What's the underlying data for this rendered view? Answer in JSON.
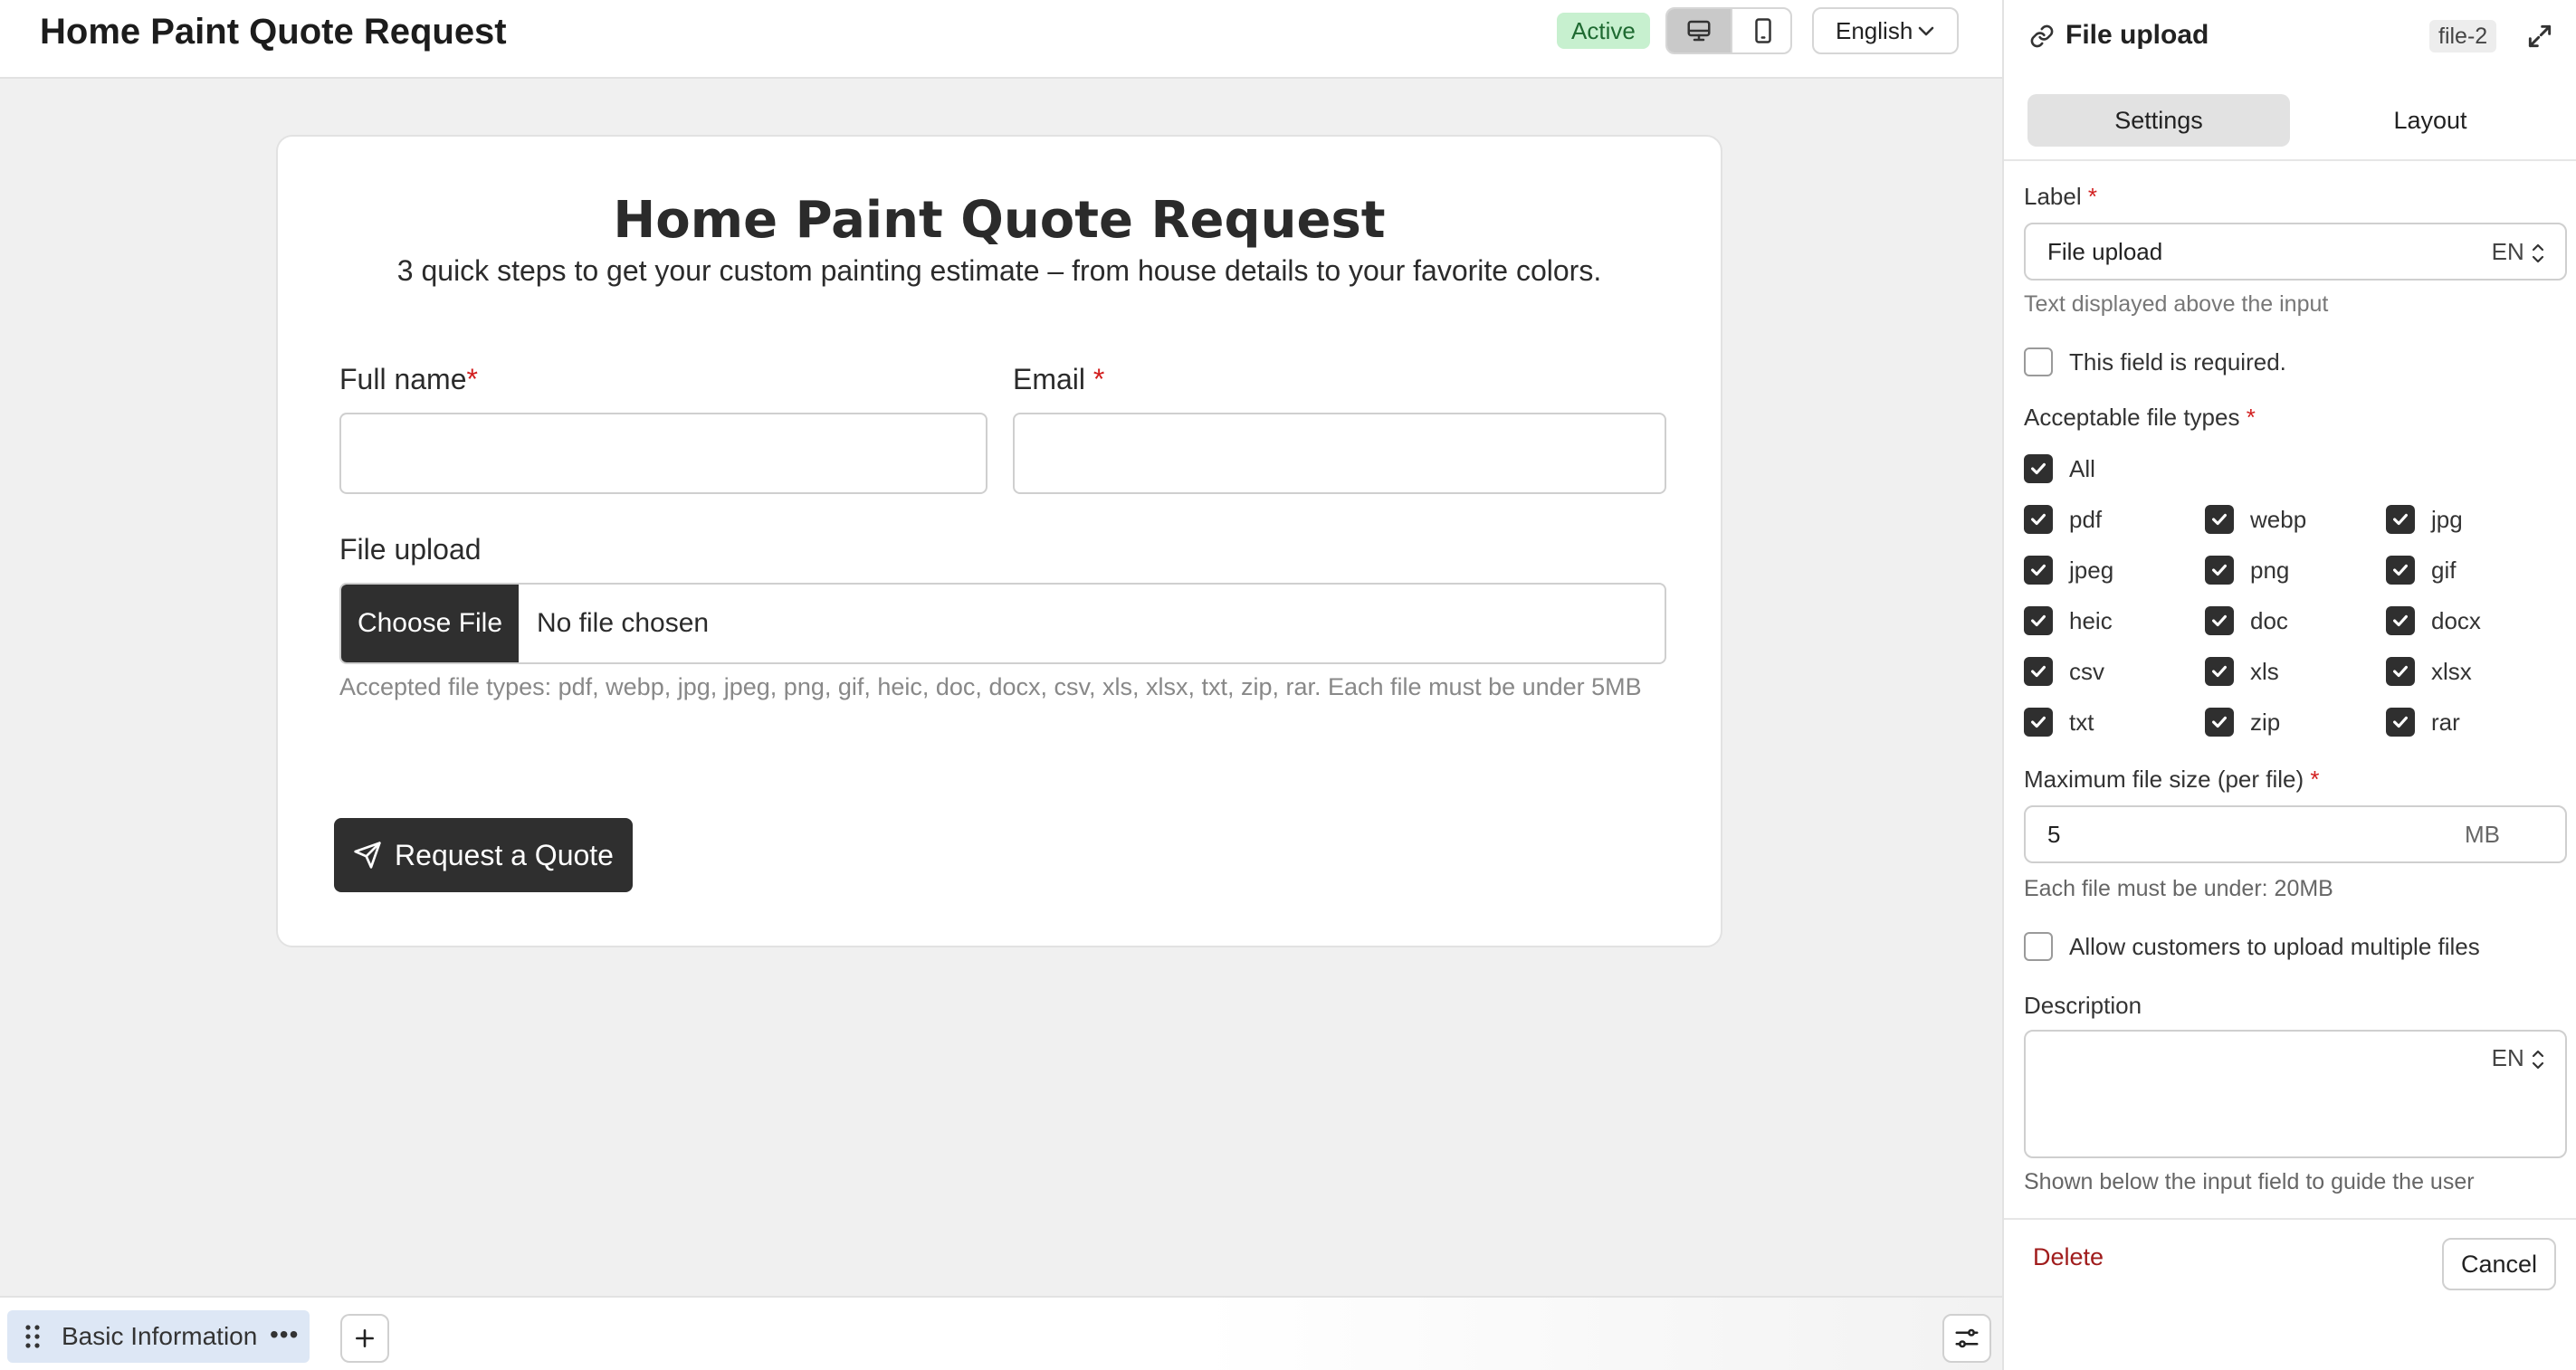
{
  "header": {
    "title": "Home Paint Quote Request",
    "status": "Active",
    "language": "English"
  },
  "form": {
    "title": "Home Paint Quote Request",
    "subtitle": "3 quick steps to get your custom painting estimate – from house details to your favorite colors.",
    "fields": {
      "full_name_label": "Full name",
      "email_label": "Email",
      "required_mark": "*",
      "file_upload_label": "File upload",
      "choose_file_label": "Choose File",
      "no_file_text": "No file chosen",
      "file_help": "Accepted file types: pdf, webp, jpg, jpeg, png, gif, heic, doc, docx, csv, xls, xlsx, txt, zip, rar. Each file must be under 5MB"
    },
    "submit_label": "Request a Quote"
  },
  "bottombar": {
    "step_label": "Basic Information",
    "more_label": "•••"
  },
  "panel": {
    "title": "File upload",
    "field_id": "file-2",
    "tabs": [
      "Settings",
      "Layout"
    ],
    "label_field": {
      "label": "Label",
      "required_mark": "*",
      "value": "File upload",
      "lang": "EN",
      "help": "Text displayed above the input"
    },
    "required_checkbox": {
      "label": "This field is required.",
      "checked": false
    },
    "file_types": {
      "label": "Acceptable file types",
      "all_label": "All",
      "items": [
        "pdf",
        "webp",
        "jpg",
        "jpeg",
        "png",
        "gif",
        "heic",
        "doc",
        "docx",
        "csv",
        "xls",
        "xlsx",
        "txt",
        "zip",
        "rar"
      ]
    },
    "max_size": {
      "label": "Maximum file size (per file)",
      "value": "5",
      "unit": "MB",
      "help": "Each file must be under: 20MB"
    },
    "multiple_checkbox": {
      "label": "Allow customers to upload multiple files",
      "checked": false
    },
    "description": {
      "label": "Description",
      "lang": "EN",
      "help": "Shown below the input field to guide the user"
    },
    "footer": {
      "delete_label": "Delete",
      "cancel_label": "Cancel"
    }
  },
  "colors": {
    "accent_dark": "#2f2f2f",
    "status_bg": "#c7f0cf",
    "required": "#d21f1f",
    "delete": "#a01c1c"
  },
  "icons": [
    "desktop-icon",
    "mobile-icon",
    "chevron-down-icon",
    "send-icon",
    "drag-handle-icon",
    "more-icon",
    "plus-icon",
    "sliders-icon",
    "link-icon",
    "expand-icon",
    "updown-icon",
    "check-icon"
  ]
}
